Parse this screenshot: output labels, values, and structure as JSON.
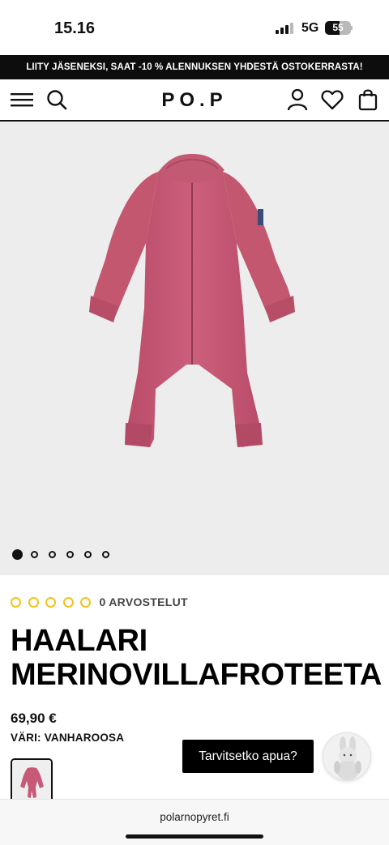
{
  "status_bar": {
    "time": "15.16",
    "network": "5G",
    "battery": "55"
  },
  "promo": {
    "text": "LIITY JÄSENEKSI, SAAT -10 % ALENNUKSEN YHDESTÄ OSTOKERRASTA!"
  },
  "header": {
    "logo": "PO.P",
    "icons": [
      "menu-icon",
      "search-icon",
      "account-icon",
      "heart-icon",
      "bag-icon"
    ]
  },
  "gallery": {
    "image_count": 6,
    "active_index": 0,
    "product_color": "#c95a77"
  },
  "product": {
    "rating_count_label": "0 ARVOSTELUT",
    "title_line1": "HAALARI",
    "title_line2": "MERINOVILLAFROTEETA",
    "price": "69,90 €",
    "color_label": "VÄRI: VANHAROOSA"
  },
  "help": {
    "label": "Tarvitsetko apua?"
  },
  "browser": {
    "url": "polarnopyret.fi"
  },
  "colors": {
    "accent_star": "#f0c419",
    "banner_bg": "#0d0d0d",
    "garment": "#c95a77"
  }
}
